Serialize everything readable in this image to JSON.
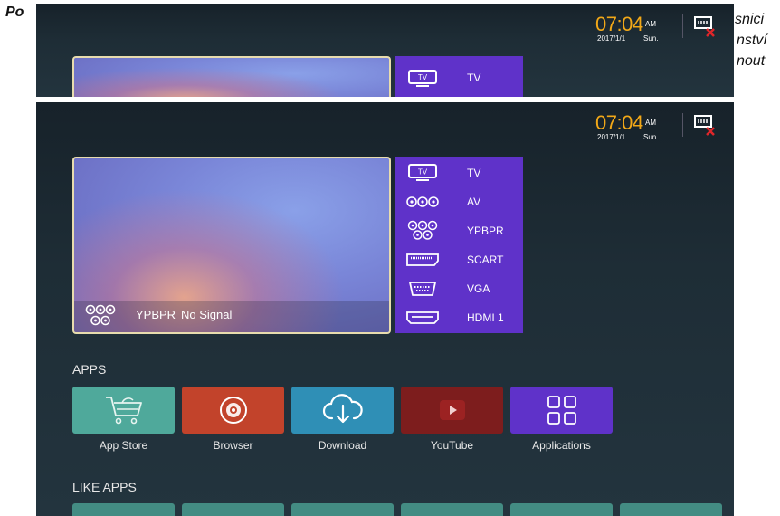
{
  "document": {
    "fragment_left": "Po",
    "fragment_right_1": "snici",
    "fragment_right_2": "nství",
    "fragment_right_3": "nout"
  },
  "status_bar": {
    "time": "07:04",
    "ampm": "AM",
    "date": "2017/1/1",
    "day": "Sun."
  },
  "preview": {
    "source": "YPBPR",
    "status": "No Signal"
  },
  "inputs": [
    {
      "label": "TV",
      "icon": "tv-icon"
    },
    {
      "label": "AV",
      "icon": "av-icon"
    },
    {
      "label": "YPBPR",
      "icon": "ypbpr-icon"
    },
    {
      "label": "SCART",
      "icon": "scart-icon"
    },
    {
      "label": "VGA",
      "icon": "vga-icon"
    },
    {
      "label": "HDMI 1",
      "icon": "hdmi-icon"
    }
  ],
  "sections": {
    "apps": "APPS",
    "like_apps": "LIKE APPS"
  },
  "apps": [
    {
      "label": "App Store",
      "icon": "shopping-cart-icon",
      "color": "#4fa99b"
    },
    {
      "label": "Browser",
      "icon": "browser-icon",
      "color": "#c2432b"
    },
    {
      "label": "Download",
      "icon": "cloud-download-icon",
      "color": "#2f8fb6"
    },
    {
      "label": "YouTube",
      "icon": "youtube-icon",
      "color": "#7d1d1d"
    },
    {
      "label": "Applications",
      "icon": "grid-icon",
      "color": "#5f32c9"
    }
  ],
  "colors": {
    "accent_clock": "#f2a818",
    "inputs_panel": "#5f32c9",
    "background": "#1e2d36"
  }
}
